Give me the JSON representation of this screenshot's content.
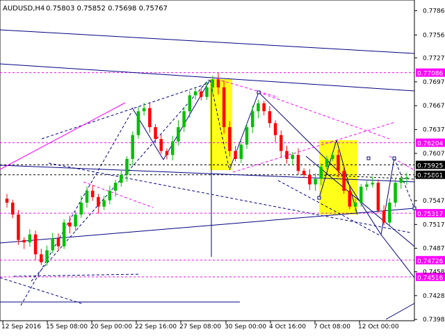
{
  "chart_data": {
    "type": "candlestick",
    "header": {
      "symbol": "AUDUSD,H4",
      "ohlc": [
        "0.75803",
        "0.75852",
        "0.75698",
        "0.75767"
      ]
    },
    "ylim": [
      0.73964,
      0.78
    ],
    "y_ticks": [
      "0.77865",
      "0.77560",
      "0.77272",
      "0.76970",
      "0.76670",
      "0.76370",
      "0.76070",
      "0.75775",
      "0.75475",
      "0.75175",
      "0.74875",
      "0.74580",
      "0.74280",
      "0.73980"
    ],
    "x_ticks": [
      "12 Sep 2016",
      "15 Sep 08:00",
      "20 Sep 00:00",
      "22 Sep 16:00",
      "27 Sep 08:00",
      "30 Sep 00:00",
      "4 Oct 16:00",
      "7 Oct 08:00",
      "12 Oct 00:00"
    ],
    "levels": [
      {
        "value": 0.77086,
        "label": "0.77086",
        "color": "#ff00ff",
        "style": "dashed-magenta"
      },
      {
        "value": 0.76204,
        "label": "0.76204",
        "color": "#ff00ff",
        "style": "dashed-magenta"
      },
      {
        "value": 0.75925,
        "label": "0.75925",
        "color": "#000000",
        "style": "dashed-black"
      },
      {
        "value": 0.75801,
        "label": "0.75801",
        "color": "#000000",
        "style": "dashed-black"
      },
      {
        "value": 0.75317,
        "label": "0.75317",
        "color": "#ff00ff",
        "style": "dashed-magenta"
      },
      {
        "value": 0.74726,
        "label": "0.74726",
        "color": "#ff00ff",
        "style": "dashed-magenta"
      },
      {
        "value": 0.74516,
        "label": "0.74516",
        "color": "#ff00ff",
        "style": "dashed-magenta"
      }
    ],
    "close_path": [
      0.7545,
      0.753,
      0.7498,
      0.7495,
      0.7505,
      0.748,
      0.747,
      0.7485,
      0.75,
      0.749,
      0.752,
      0.7515,
      0.753,
      0.7545,
      0.756,
      0.7552,
      0.754,
      0.7548,
      0.756,
      0.757,
      0.758,
      0.76,
      0.763,
      0.766,
      0.7664,
      0.764,
      0.7625,
      0.761,
      0.7605,
      0.7622,
      0.764,
      0.766,
      0.768,
      0.7685,
      0.7678,
      0.769,
      0.77,
      0.769,
      0.764,
      0.761,
      0.76,
      0.7618,
      0.764,
      0.766,
      0.767,
      0.766,
      0.7645,
      0.763,
      0.761,
      0.76,
      0.7605,
      0.7585,
      0.758,
      0.7568,
      0.7575,
      0.759,
      0.76,
      0.7605,
      0.7585,
      0.756,
      0.754,
      0.7545,
      0.7565,
      0.7568,
      0.757,
      0.7535,
      0.752,
      0.7545,
      0.757,
      0.7575,
      0.7577
    ],
    "colors": {
      "bull": "#00c000",
      "bear": "#ff0000",
      "trend": "#000080",
      "fib": "#ff00ff",
      "highlight": "#ffff00"
    }
  }
}
